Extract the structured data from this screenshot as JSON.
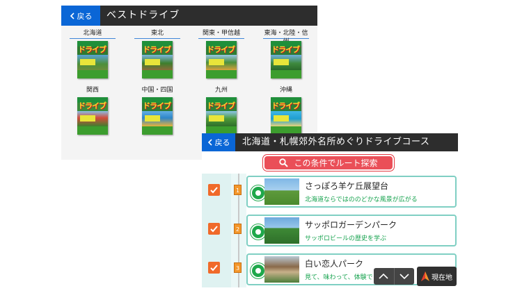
{
  "back_screen": {
    "back_label": "戻る",
    "title": "ベストドライブ",
    "regions": [
      {
        "label": "北海道",
        "book_title": "ドライブ"
      },
      {
        "label": "東北",
        "book_title": "ドライブ"
      },
      {
        "label": "関東・甲信越",
        "book_title": "ドライブ"
      },
      {
        "label": "東海・北陸・信州",
        "book_title": "ドライブ"
      },
      {
        "label": "関西",
        "book_title": "ドライブ"
      },
      {
        "label": "中国・四国",
        "book_title": "ドライブ"
      },
      {
        "label": "九州",
        "book_title": "ドライブ"
      },
      {
        "label": "沖縄",
        "book_title": "ドライブ"
      }
    ]
  },
  "front_screen": {
    "back_label": "戻る",
    "title": "北海道・札幌郊外名所めぐりドライブコース",
    "search_button_label": "この条件でルート探索",
    "spots": [
      {
        "number": "1",
        "checked": true,
        "name": "さっぽろ羊ケ丘展望台",
        "description": "北海道ならではののどかな風景が広がる"
      },
      {
        "number": "2",
        "checked": true,
        "name": "サッポロガーデンパーク",
        "description": "サッポロビールの歴史を学ぶ"
      },
      {
        "number": "3",
        "checked": true,
        "name": "白い恋人パーク",
        "description": "見て、味わって、体験できる"
      }
    ],
    "current_position_label": "現在地"
  },
  "colors": {
    "header_bg": "#2d2d2d",
    "back_button": "#0a66d6",
    "search_button": "#ea4f58",
    "checkbox": "#f06a2a",
    "spot_border": "#7fcfc3",
    "description_text": "#15a24d"
  },
  "icons": {
    "back": "chevron-left-icon",
    "search": "search-icon",
    "spot": "spot-marker-icon",
    "scroll_up": "chevron-up-icon",
    "scroll_down": "chevron-down-icon",
    "current_position": "compass-arrow-icon"
  }
}
